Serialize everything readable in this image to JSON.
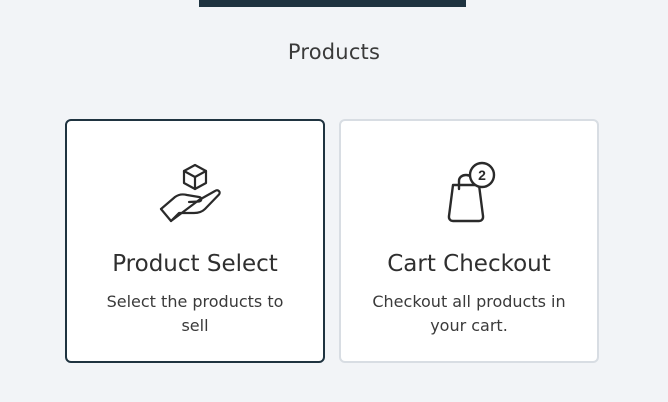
{
  "section": {
    "title": "Products"
  },
  "cards": [
    {
      "icon": "hand-with-box-icon",
      "title": "Product Select",
      "description": "Select the products to sell",
      "selected": true
    },
    {
      "icon": "shopping-bag-icon",
      "badge": "2",
      "title": "Cart Checkout",
      "description": "Checkout all products in your cart.",
      "selected": false
    }
  ],
  "colors": {
    "accent": "#1f3340",
    "background": "#f2f4f7",
    "card_border": "#d8dde3"
  }
}
